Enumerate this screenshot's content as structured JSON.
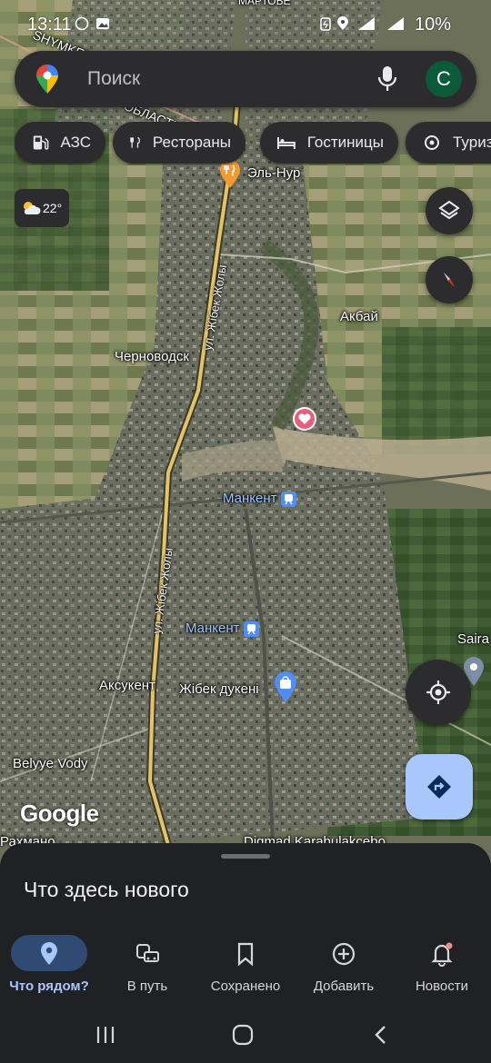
{
  "status_bar": {
    "time": "13:11",
    "battery": "10%"
  },
  "search": {
    "placeholder": "Поиск",
    "avatar_letter": "C"
  },
  "chips": [
    {
      "label": "АЗС",
      "icon": "gas-station-icon"
    },
    {
      "label": "Рестораны",
      "icon": "restaurant-icon"
    },
    {
      "label": "Гостиницы",
      "icon": "hotel-icon"
    },
    {
      "label": "Туризм",
      "icon": "attraction-icon"
    }
  ],
  "weather": {
    "temp": "22°",
    "icon": "partly-cloudy-icon"
  },
  "map_labels": {
    "top_partial": "МАРТОБЕ",
    "shymkent": "SHYMKENT",
    "oblast": "ОБЛАСТЬ",
    "el_nur": "Эль-Нур",
    "akbai": "Акбай",
    "chernovodsk": "Черноводск",
    "mankent_top": "Манкент",
    "mankent_mid": "Манкент",
    "saira": "Saira",
    "aksukent": "Аксукент",
    "zhibek_dukeni": "Жібек дукені",
    "belyye_vody": "Belyye Vody",
    "rakhmanov": "Рахмано",
    "bottom_partial": "Diqmad Karabulakcebo",
    "road_upper": "ул. Жібек Жолы",
    "road_lower": "ул. Жібек Жолы"
  },
  "google_logo": "Google",
  "sheet": {
    "title": "Что здесь нового"
  },
  "nav_tabs": [
    {
      "label": "Что рядом?",
      "icon": "location-pin-icon",
      "active": true
    },
    {
      "label": "В путь",
      "icon": "commute-icon",
      "active": false
    },
    {
      "label": "Сохранено",
      "icon": "bookmark-icon",
      "active": false
    },
    {
      "label": "Добавить",
      "icon": "add-circle-icon",
      "active": false
    },
    {
      "label": "Новости",
      "icon": "bell-icon",
      "active": false
    }
  ],
  "colors": {
    "active_pill": "#2f4a73",
    "active_label": "#a8c7fa",
    "accent_blue": "#4f8ef7",
    "route_button": "#a8c7fa"
  }
}
